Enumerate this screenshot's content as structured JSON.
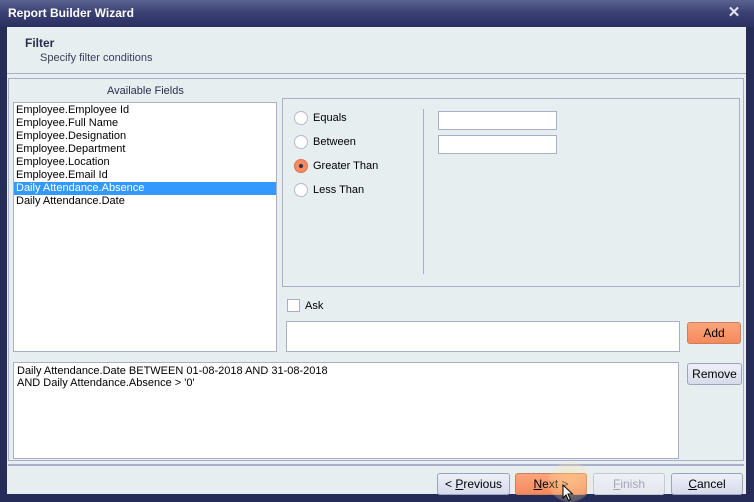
{
  "window": {
    "title": "Report Builder Wizard",
    "close_icon": "close-icon"
  },
  "header": {
    "title": "Filter",
    "subtitle": "Specify filter conditions"
  },
  "available_fields": {
    "label": "Available Fields",
    "items": [
      {
        "label": "Employee.Employee Id",
        "selected": false
      },
      {
        "label": "Employee.Full Name",
        "selected": false
      },
      {
        "label": "Employee.Designation",
        "selected": false
      },
      {
        "label": "Employee.Department",
        "selected": false
      },
      {
        "label": "Employee.Location",
        "selected": false
      },
      {
        "label": "Employee.Email Id",
        "selected": false
      },
      {
        "label": "Daily Attendance.Absence",
        "selected": true
      },
      {
        "label": "Daily Attendance.Date",
        "selected": false
      }
    ]
  },
  "conditions": {
    "options": [
      {
        "label": "Equals",
        "checked": false
      },
      {
        "label": "Between",
        "checked": false
      },
      {
        "label": "Greater Than",
        "checked": true
      },
      {
        "label": "Less Than",
        "checked": false
      }
    ],
    "value1": "",
    "value2": ""
  },
  "ask": {
    "label": "Ask",
    "checked": false
  },
  "expression_value": "",
  "buttons": {
    "add": "Add",
    "remove": "Remove",
    "previous_prefix": "< ",
    "previous_mnemonic": "P",
    "previous_rest": "revious",
    "next_mnemonic": "N",
    "next_rest": "ext >",
    "finish_mnemonic": "F",
    "finish_rest": "inish",
    "cancel_mnemonic": "C",
    "cancel_rest": "ancel"
  },
  "filter_text": {
    "lines": [
      "Daily Attendance.Date BETWEEN 01-08-2018 AND 31-08-2018",
      "AND Daily Attendance.Absence > '0'"
    ]
  },
  "colors": {
    "accent_orange": "#f58a5c",
    "selection_blue": "#3399ff",
    "titlebar": "#2a3060"
  }
}
